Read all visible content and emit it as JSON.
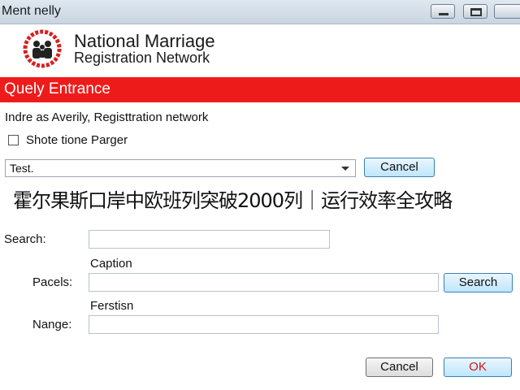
{
  "window": {
    "title": "Ment nelly"
  },
  "header": {
    "brand_line1": "National Marriage",
    "brand_line2": "Registration Network",
    "logo_icon": "family-logo-icon",
    "logo_color": "#d62020"
  },
  "banner": {
    "title": "Quely Entrance",
    "color": "#ee1b1b"
  },
  "subtitle": "Indre as Averily, Registtration network",
  "checkbox": {
    "label": "Shote tione Parger",
    "checked": false
  },
  "dropdown": {
    "value": "Test."
  },
  "top_cancel_label": "Cancel",
  "overlay_caption": "霍尔果斯口岸中欧班列突破2000列｜运行效率全攻略",
  "form": {
    "search_label": "Search:",
    "search_value": "",
    "caption_label": "Caption",
    "pacels_label": "Pacels:",
    "pacels_value": "",
    "search_button": "Search",
    "ferstisn_label": "Ferstisn",
    "nange_label": "Nange:",
    "nange_value": ""
  },
  "footer": {
    "cancel_label": "Cancel",
    "ok_label": "OK"
  }
}
